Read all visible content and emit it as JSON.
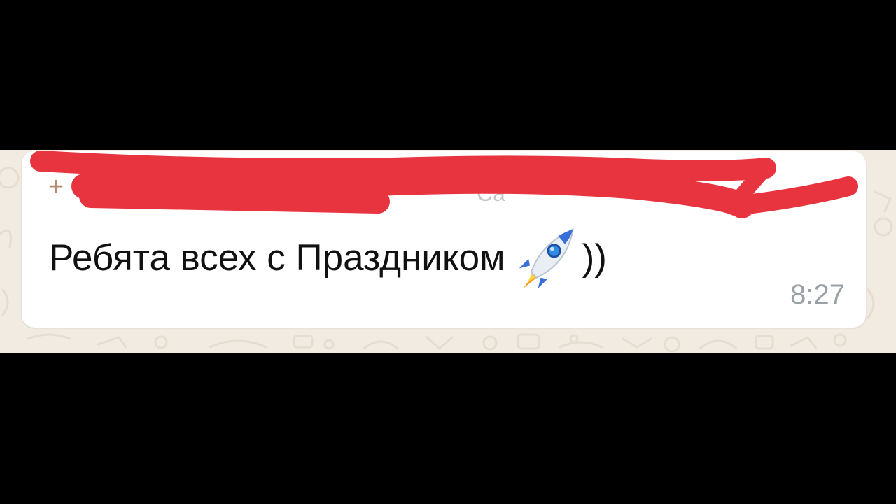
{
  "message": {
    "sender_prefix": "+",
    "sender_partial": "Ca",
    "text": "Ребята всех с Праздником",
    "emoji": "rocket-icon",
    "suffix": "))",
    "time": "8:27"
  },
  "colors": {
    "letterbox": "#000000",
    "wallpaper": "#f2ebe1",
    "bubble": "#ffffff",
    "redaction": "#e8343e",
    "timestamp": "#9aa1a6",
    "sender_prefix": "#b58a6e"
  }
}
